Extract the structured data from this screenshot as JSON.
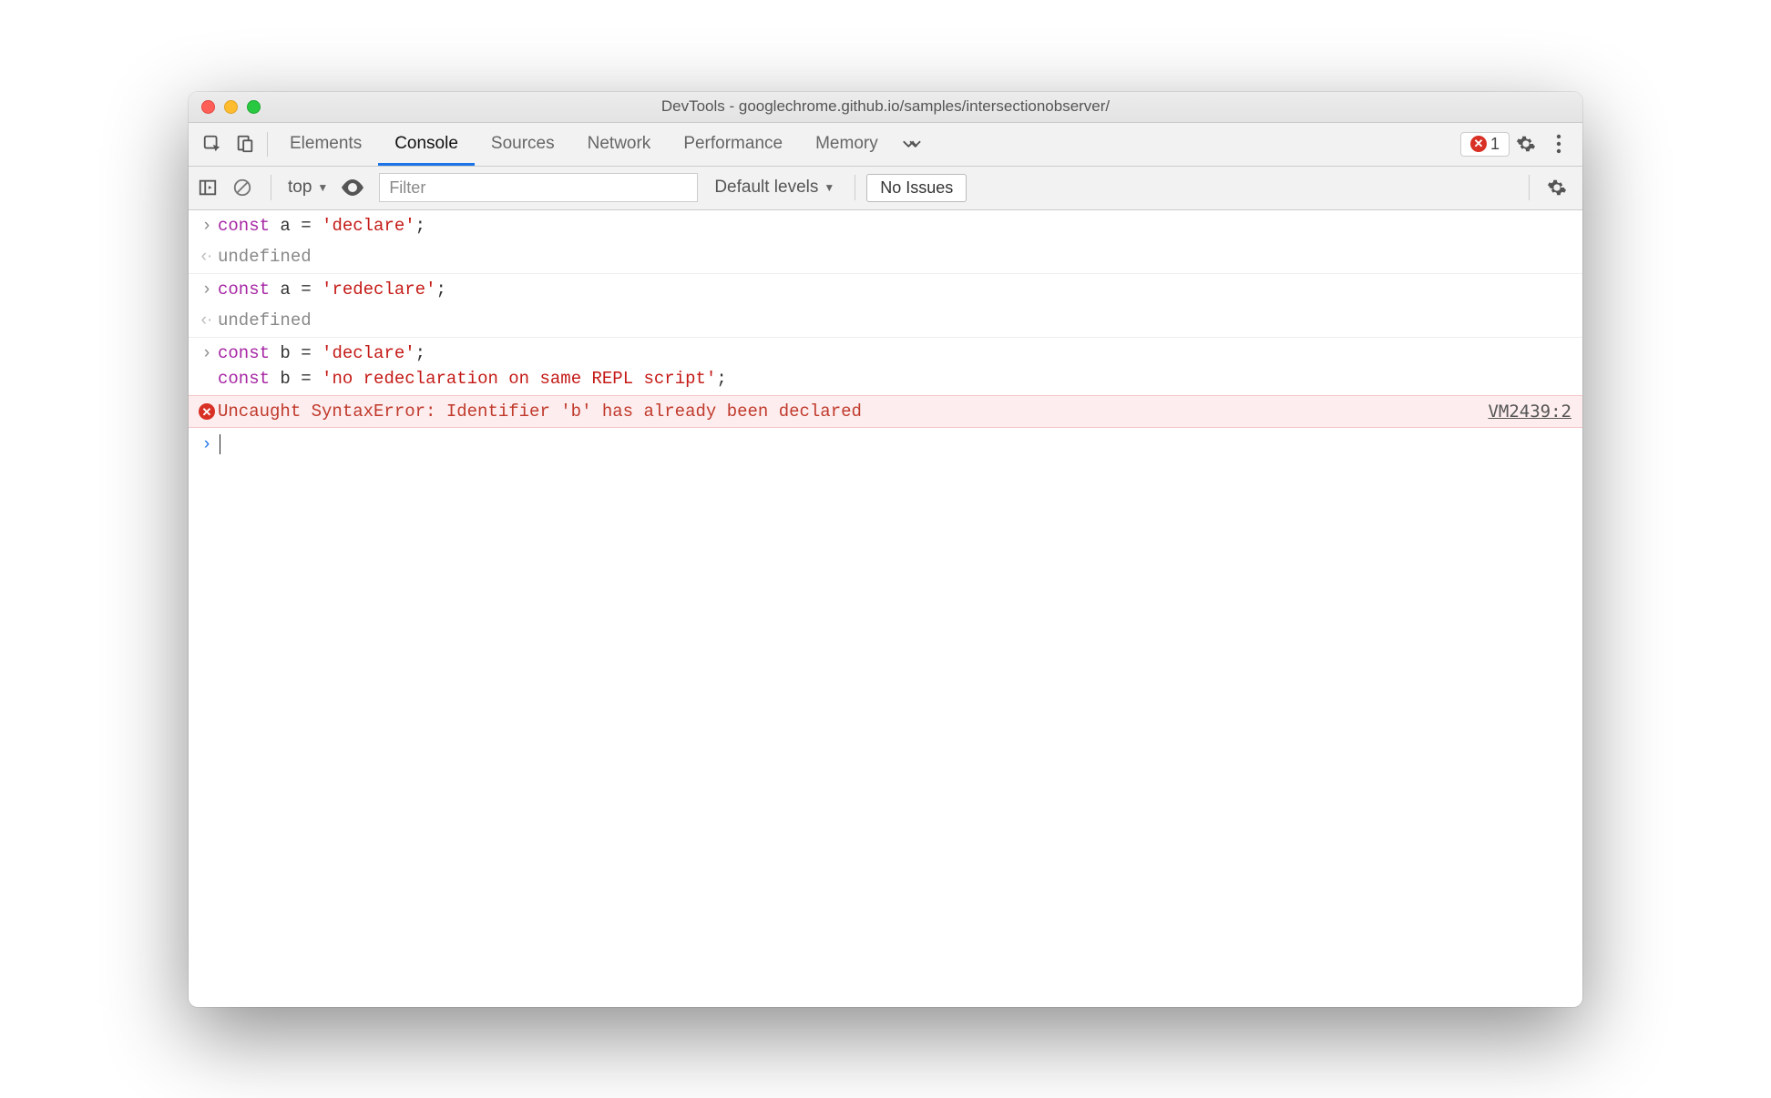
{
  "window": {
    "title": "DevTools - googlechrome.github.io/samples/intersectionobserver/"
  },
  "tabs": {
    "items": [
      "Elements",
      "Console",
      "Sources",
      "Network",
      "Performance",
      "Memory"
    ],
    "active": "Console",
    "error_count": "1"
  },
  "toolbar": {
    "context": "top",
    "filter_placeholder": "Filter",
    "levels": "Default levels",
    "issues_label": "No Issues"
  },
  "console": {
    "entries": [
      {
        "type": "input",
        "tokens": [
          [
            "kw",
            "const"
          ],
          [
            "pl",
            " a "
          ],
          [
            "op",
            "="
          ],
          [
            "pl",
            " "
          ],
          [
            "str",
            "'declare'"
          ],
          [
            "op",
            ";"
          ]
        ]
      },
      {
        "type": "output",
        "text": "undefined"
      },
      {
        "type": "input",
        "tokens": [
          [
            "kw",
            "const"
          ],
          [
            "pl",
            " a "
          ],
          [
            "op",
            "="
          ],
          [
            "pl",
            " "
          ],
          [
            "str",
            "'redeclare'"
          ],
          [
            "op",
            ";"
          ]
        ]
      },
      {
        "type": "output",
        "text": "undefined"
      },
      {
        "type": "input-multi",
        "lines": [
          [
            [
              "kw",
              "const"
            ],
            [
              "pl",
              " b "
            ],
            [
              "op",
              "="
            ],
            [
              "pl",
              " "
            ],
            [
              "str",
              "'declare'"
            ],
            [
              "op",
              ";"
            ]
          ],
          [
            [
              "kw",
              "const"
            ],
            [
              "pl",
              " b "
            ],
            [
              "op",
              "="
            ],
            [
              "pl",
              " "
            ],
            [
              "str",
              "'no redeclaration on same REPL script'"
            ],
            [
              "op",
              ";"
            ]
          ]
        ]
      },
      {
        "type": "error",
        "text": "Uncaught SyntaxError: Identifier 'b' has already been declared",
        "source": "VM2439:2"
      }
    ]
  },
  "icons": {
    "inspect": "inspect-icon",
    "device": "device-icon",
    "overflow": "overflow-icon",
    "play": "play-icon",
    "clear": "clear-icon",
    "eye": "eye-icon",
    "gear": "gear-icon",
    "more": "more-icon"
  }
}
